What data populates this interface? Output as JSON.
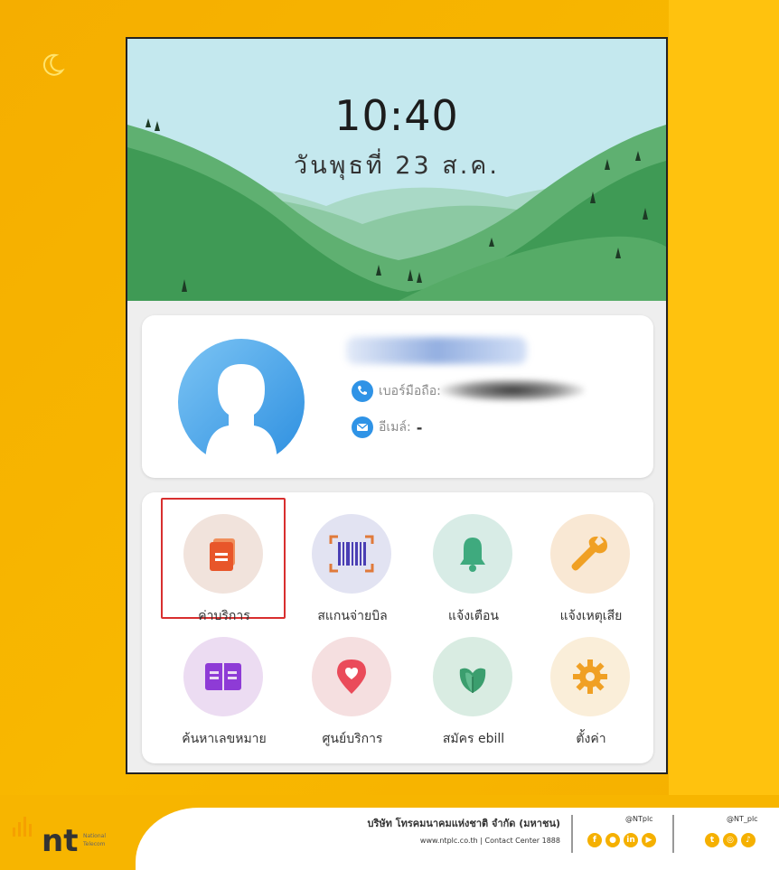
{
  "lockscreen": {
    "time": "10:40",
    "date": "วันพุธที่ 23 ส.ค."
  },
  "profile": {
    "phone_label": "เบอร์มือถือ:",
    "email_label": "อีเมล์:",
    "email_value": "-"
  },
  "menu": {
    "items": [
      {
        "label": "ค่าบริการ",
        "icon": "invoice-icon",
        "selected": true
      },
      {
        "label": "สแกนจ่ายบิล",
        "icon": "barcode-scan-icon"
      },
      {
        "label": "แจ้งเตือน",
        "icon": "bell-icon"
      },
      {
        "label": "แจ้งเหตุเสีย",
        "icon": "wrench-icon"
      },
      {
        "label": "ค้นหาเลขหมาย",
        "icon": "book-icon"
      },
      {
        "label": "ศูนย์บริการ",
        "icon": "location-pin-icon"
      },
      {
        "label": "สมัคร ebill",
        "icon": "leaf-icon"
      },
      {
        "label": "ตั้งค่า",
        "icon": "gear-icon"
      }
    ]
  },
  "footer": {
    "logo_text": "nt",
    "logo_sub1": "National",
    "logo_sub2": "Telecom",
    "company": "บริษัท โทรคมนาคมแห่งชาติ จำกัด (มหาชน)",
    "site": "www.ntplc.co.th | Contact Center 1888",
    "handle1": "@NTplc",
    "handle2": "@NT_plc"
  },
  "colors": {
    "brand_yellow": "#f7b500",
    "selection_red": "#d82f2f",
    "hill_green": "#3f9a55",
    "sky": "#b9e3ea"
  }
}
